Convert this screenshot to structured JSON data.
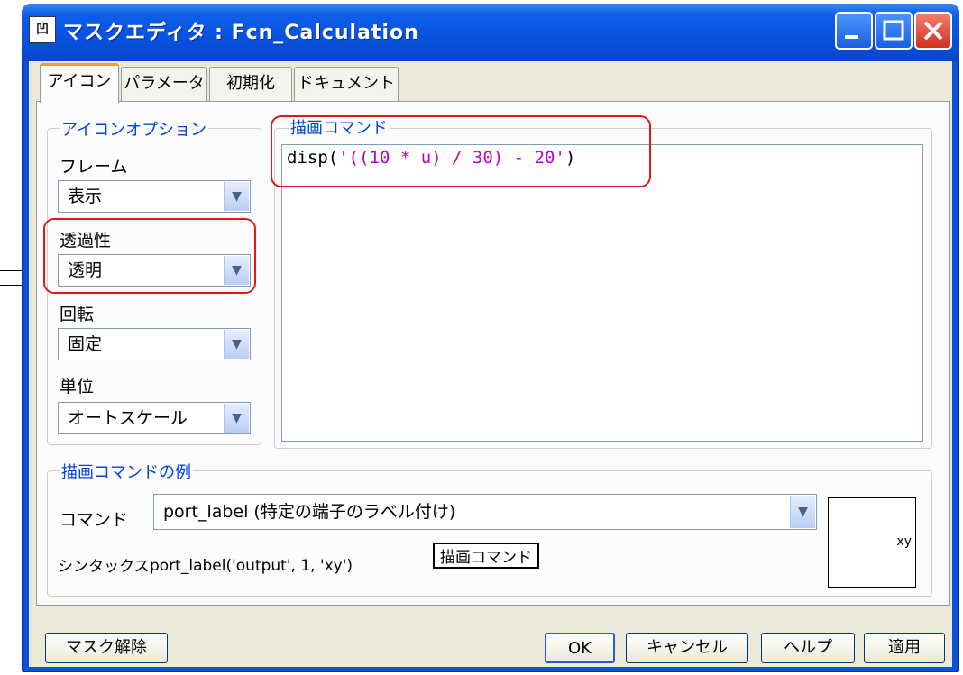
{
  "window": {
    "title": "マスクエディタ : Fcn_Calculation",
    "icon_text": "凹"
  },
  "tabs": [
    "アイコン",
    "パラメータ",
    "初期化",
    "ドキュメント"
  ],
  "icon_options": {
    "group_label": "アイコンオプション",
    "frame": {
      "label": "フレーム",
      "value": "表示"
    },
    "transparency": {
      "label": "透過性",
      "value": "透明"
    },
    "rotation": {
      "label": "回転",
      "value": "固定"
    },
    "units": {
      "label": "単位",
      "value": "オートスケール"
    }
  },
  "drawing_commands": {
    "group_label": "描画コマンド",
    "code_prefix": "disp(",
    "code_string": "'((10 * u) / 30) - 20'",
    "code_suffix": ")"
  },
  "examples": {
    "group_label": "描画コマンドの例",
    "command_label": "コマンド",
    "command_value": "port_label (特定の端子のラベル付け)",
    "syntax_label": "シンタックス",
    "syntax_value": "port_label('output', 1, 'xy')",
    "callout": "描画コマンド",
    "preview_text": "xy"
  },
  "buttons": {
    "unmask": "マスク解除",
    "ok": "OK",
    "cancel": "キャンセル",
    "help": "ヘルプ",
    "apply": "適用"
  },
  "colors": {
    "title_blue": "#0852e0",
    "highlight_red": "#e01818",
    "string_magenta": "#c000c0"
  }
}
